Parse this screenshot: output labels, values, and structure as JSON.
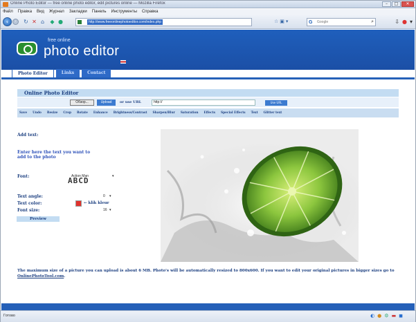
{
  "window": {
    "title": "Online Photo Editor — free online photo editor, edit pictures online — Mozilla Firefox",
    "controls": {
      "minimize": "–",
      "maximize": "□",
      "close": "✕"
    }
  },
  "menubar": {
    "items": [
      "Файл",
      "Правка",
      "Вид",
      "Журнал",
      "Закладки",
      "Панель",
      "Инструменты",
      "Справка"
    ]
  },
  "navbar": {
    "url": "http://www.freeonlinephotoeditor.com/index.php",
    "search_engine": "Google",
    "back_icon": "back-arrow-icon",
    "forward_icon": "forward-arrow-icon"
  },
  "site": {
    "logo_small": "free online",
    "logo_big": "photo editor",
    "tabs": [
      {
        "label": "Photo Editor",
        "active": true
      },
      {
        "label": "Links",
        "active": false
      },
      {
        "label": "Contact",
        "active": false
      }
    ],
    "content_title": "Online Photo Editor",
    "upload": {
      "browse_label": "Обзор...",
      "upload_label": "Upload",
      "or_url_label": "or use URL",
      "url_value": "http://",
      "url_button_label": "Use URL"
    },
    "tools": [
      "Save",
      "Undo",
      "Resize",
      "Crop",
      "Rotate",
      "Enhance",
      "Brightness/Contrast",
      "Sharpen/Blur",
      "Saturation",
      "Effects",
      "Special Effects",
      "Text",
      "Glitter text"
    ],
    "text_panel": {
      "heading": "Add text:",
      "instruction": "Enter here the text you want to add to the photo",
      "font_label": "Font:",
      "font_value": "Action Man",
      "font_preview": "ABCD",
      "angle_label": "Text angle:",
      "angle_value": "0",
      "color_label": "Text color:",
      "color_hint": "← klik kleur",
      "color_value": "#e1322d",
      "size_label": "Font size:",
      "size_value": "16",
      "preview_label": "Preview"
    },
    "bottom_note_prefix": "The maximum size of a picture you can upload is about 6 MB. Photo's will be automatically resized to 800x600. If you want to edit your original pictures in bigger sizes go to ",
    "bottom_note_link": "OnlinePhotoTool.com",
    "bottom_note_suffix": "."
  },
  "statusbar": {
    "text": "Готово"
  },
  "colors": {
    "brand_blue": "#2560b8",
    "light_blue": "#c3dcf2",
    "text_blue": "#1c3f80"
  }
}
